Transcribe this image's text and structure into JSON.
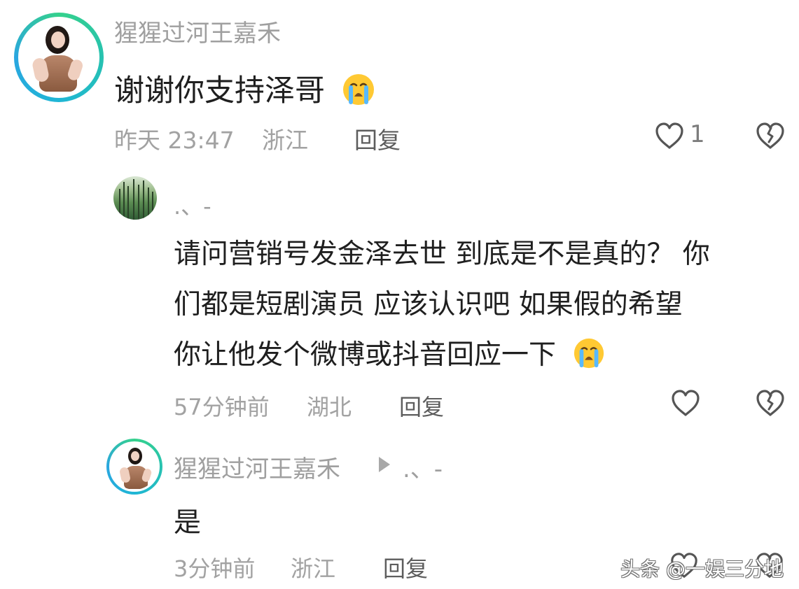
{
  "comments": {
    "main": {
      "username": "猩猩过河王嘉禾",
      "text": "谢谢你支持泽哥",
      "meta_time": "昨天 23:47",
      "meta_location": "浙江",
      "reply_label": "回复",
      "like_count": "1"
    },
    "reply1": {
      "username": ".、-",
      "text_lines": [
        "请问营销号发金泽去世 到底是不是真的？ 你",
        "们都是短剧演员 应该认识吧 如果假的希望",
        "你让他发个微博或抖音回应一下"
      ],
      "meta_time": "57分钟前",
      "meta_location": "湖北",
      "reply_label": "回复"
    },
    "reply2": {
      "username": "猩猩过河王嘉禾",
      "reply_to": ".、-",
      "text": "是",
      "meta_time": "3分钟前",
      "meta_location": "浙江",
      "reply_label": "回复"
    }
  },
  "watermark": {
    "text": "头条 @一娱三分地"
  },
  "icons": {
    "like": "heart-outline-icon",
    "dislike": "broken-heart-icon",
    "emoji": "crying-face-emoji-icon",
    "arrow": "play-triangle-icon"
  },
  "colors": {
    "username": "#9f9f9f",
    "body_text": "#1f1f1f",
    "meta": "#a2a2a2",
    "reply": "#5d5d5d",
    "icon": "#555555",
    "avatar_ring_start": "#35d18c",
    "avatar_ring_end": "#2aa6e0"
  }
}
